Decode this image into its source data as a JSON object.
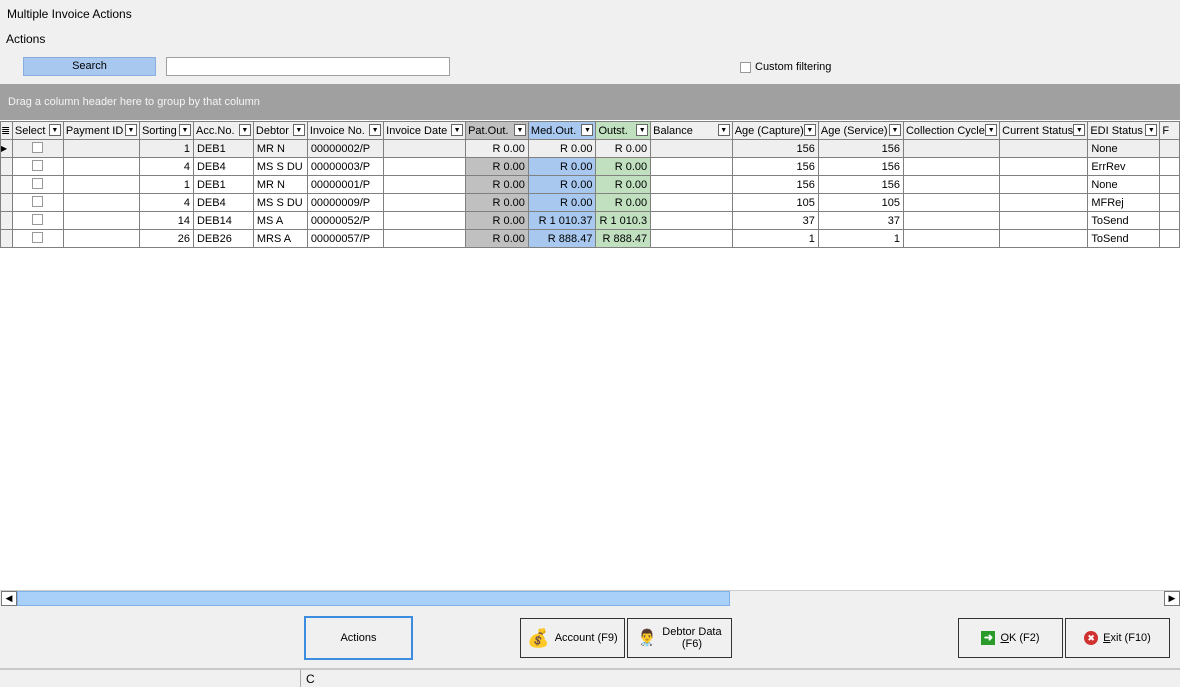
{
  "window": {
    "title": "Multiple Invoice Actions"
  },
  "menu": {
    "actions": "Actions"
  },
  "search": {
    "button": "Search",
    "value": "",
    "custom_filtering": "Custom filtering"
  },
  "groupbar": {
    "hint": "Drag a column header here to group by that column"
  },
  "grid": {
    "columns": [
      "Select",
      "Payment ID",
      "Sorting",
      "Acc.No.",
      "Debtor",
      "Invoice No.",
      "Invoice Date",
      "Pat.Out.",
      "Med.Out.",
      "Outst.",
      "Balance",
      "Age (Capture)",
      "Age (Service)",
      "Collection Cycle",
      "Current Status",
      "EDI Status",
      "F"
    ],
    "rows": [
      {
        "sorting": "1",
        "acc": "DEB1",
        "debtor": "MR N",
        "invoice": "00000002/P",
        "pat": "R 0.00",
        "med": "R 0.00",
        "outst": "R 0.00",
        "age_c": "156",
        "age_s": "156",
        "edi": "None"
      },
      {
        "sorting": "4",
        "acc": "DEB4",
        "debtor": "MS S DU",
        "invoice": "00000003/P",
        "pat": "R 0.00",
        "med": "R 0.00",
        "outst": "R 0.00",
        "age_c": "156",
        "age_s": "156",
        "edi": "ErrRev"
      },
      {
        "sorting": "1",
        "acc": "DEB1",
        "debtor": "MR N",
        "invoice": "00000001/P",
        "pat": "R 0.00",
        "med": "R 0.00",
        "outst": "R 0.00",
        "age_c": "156",
        "age_s": "156",
        "edi": "None"
      },
      {
        "sorting": "4",
        "acc": "DEB4",
        "debtor": "MS S DU",
        "invoice": "00000009/P",
        "pat": "R 0.00",
        "med": "R 0.00",
        "outst": "R 0.00",
        "age_c": "105",
        "age_s": "105",
        "edi": "MFRej"
      },
      {
        "sorting": "14",
        "acc": "DEB14",
        "debtor": "MS A",
        "invoice": "00000052/P",
        "pat": "R 0.00",
        "med": "R 1 010.37",
        "outst": "R 1 010.3",
        "age_c": "37",
        "age_s": "37",
        "edi": "ToSend"
      },
      {
        "sorting": "26",
        "acc": "DEB26",
        "debtor": "MRS A",
        "invoice": "00000057/P",
        "pat": "R 0.00",
        "med": "R 888.47",
        "outst": "R 888.47",
        "age_c": "1",
        "age_s": "1",
        "edi": "ToSend"
      }
    ]
  },
  "buttons": {
    "actions": "Actions",
    "account": "Account (F9)",
    "debtor_data": "Debtor Data (F6)",
    "ok_u": "O",
    "ok_rest": "K (F2)",
    "exit_u": "E",
    "exit_rest": "xit (F10)"
  },
  "status": {
    "text": "C"
  }
}
